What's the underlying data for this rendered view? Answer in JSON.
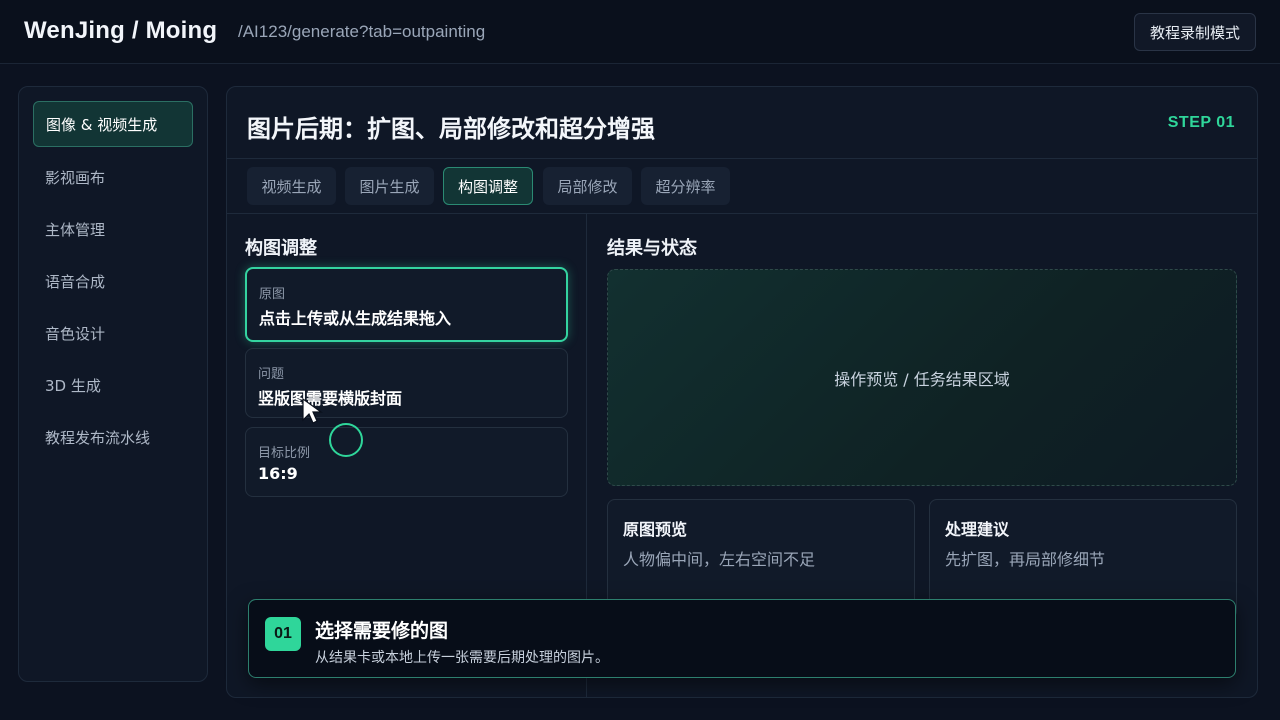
{
  "header": {
    "brand": "WenJing / Moing",
    "path": "/AI123/generate?tab=outpainting",
    "record_button": "教程录制模式"
  },
  "sidebar": {
    "items": [
      {
        "label": "图像 & 视频生成",
        "active": true
      },
      {
        "label": "影视画布",
        "active": false
      },
      {
        "label": "主体管理",
        "active": false
      },
      {
        "label": "语音合成",
        "active": false
      },
      {
        "label": "音色设计",
        "active": false
      },
      {
        "label": "3D 生成",
        "active": false
      },
      {
        "label": "教程发布流水线",
        "active": false
      }
    ]
  },
  "main": {
    "title": "图片后期：扩图、局部修改和超分增强",
    "step": "STEP 01",
    "tabs": [
      {
        "label": "视频生成",
        "active": false
      },
      {
        "label": "图片生成",
        "active": false
      },
      {
        "label": "构图调整",
        "active": true
      },
      {
        "label": "局部修改",
        "active": false
      },
      {
        "label": "超分辨率",
        "active": false
      }
    ],
    "left": {
      "title": "构图调整",
      "fields": [
        {
          "label": "原图",
          "value": "点击上传或从生成结果拖入"
        },
        {
          "label": "问题",
          "value": "竖版图需要横版封面"
        },
        {
          "label": "目标比例",
          "value": "16:9"
        }
      ]
    },
    "right": {
      "title": "结果与状态",
      "preview_text": "操作预览 / 任务结果区域",
      "cards": [
        {
          "title": "原图预览",
          "text": "人物偏中间，左右空间不足"
        },
        {
          "title": "处理建议",
          "text": "先扩图，再局部修细节"
        }
      ]
    }
  },
  "tip": {
    "number": "01",
    "title": "选择需要修的图",
    "text": "从结果卡或本地上传一张需要后期处理的图片。"
  },
  "colors": {
    "accent": "#2fd69a",
    "background": "#0c1220",
    "panel": "#0f1726"
  }
}
